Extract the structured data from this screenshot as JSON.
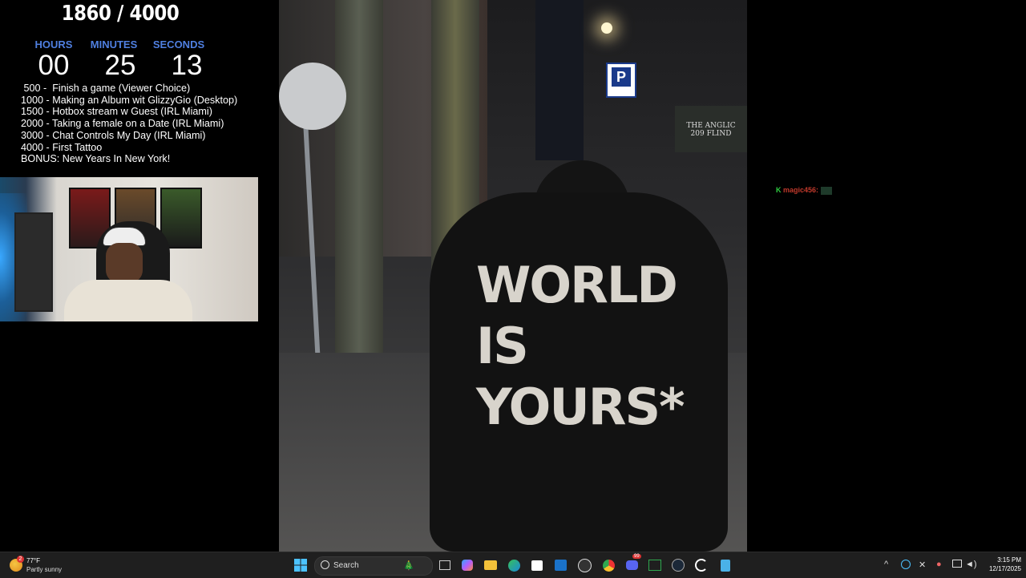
{
  "overlay": {
    "sub_count": "1860 / 4000",
    "timer": {
      "hours_label": "HOURS",
      "minutes_label": "MINUTES",
      "seconds_label": "SECONDS",
      "hours": "00",
      "minutes": "25",
      "seconds": "13"
    },
    "goals": [
      " 500 -  Finish a game (Viewer Choice)",
      "1000 - Making an Album wit GlizzyGio (Desktop)",
      "1500 - Hotbox stream w Guest (IRL Miami)",
      "2000 - Taking a female on a Date (IRL Miami)",
      "3000 - Chat Controls My Day (IRL Miami)",
      "4000 - First Tattoo",
      "BONUS: New Years In New York!"
    ]
  },
  "photo": {
    "hoodie_line1": "WORLD",
    "hoodie_line2": "IS",
    "hoodie_line3": "YOURS*",
    "parking_sign": "P",
    "building_sign_line1": "THE ANGLIC",
    "building_sign_line2": "209 FLIND"
  },
  "chat": {
    "user_initial": "K",
    "username": "magic456:"
  },
  "taskbar": {
    "weather_temp": "77°F",
    "weather_desc": "Partly sunny",
    "weather_badge": "2",
    "search_placeholder": "Search",
    "clock_time": "3:15 PM",
    "clock_date": "12/17/2025",
    "discord_badge": "99"
  },
  "colors": {
    "timer_label": "#4f7fe0",
    "taskbar_bg": "#1f1f1f",
    "chat_name": "#c0392b",
    "chat_initial": "#2ecc40"
  }
}
